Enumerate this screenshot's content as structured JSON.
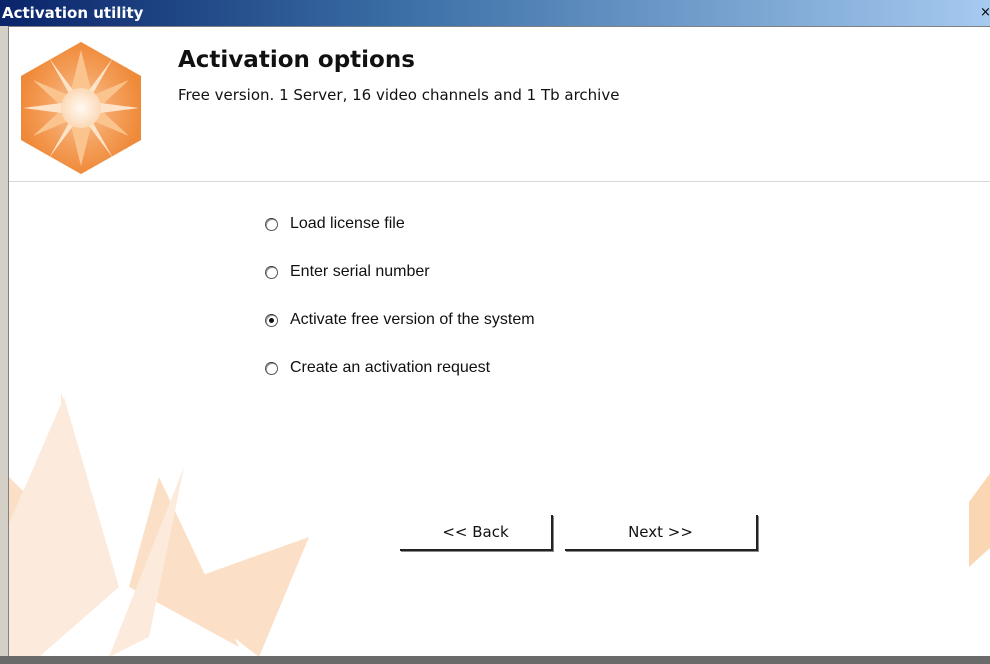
{
  "window": {
    "title": "Activation utility",
    "close_glyph": "×"
  },
  "header": {
    "heading": "Activation options",
    "subheading": "Free version. 1 Server, 16 video channels and 1 Tb archive"
  },
  "options": [
    {
      "label": "Load license file",
      "selected": false
    },
    {
      "label": "Enter serial number",
      "selected": false
    },
    {
      "label": "Activate free version of the system",
      "selected": true
    },
    {
      "label": "Create an activation request",
      "selected": false
    }
  ],
  "buttons": {
    "back_label": "<< Back",
    "next_label": "Next >>"
  },
  "colors": {
    "accent": "#f0903c",
    "titlebar_start": "#0a246a",
    "titlebar_end": "#a6caf0"
  },
  "icons": {
    "logo": "orange-hexagon-star-logo",
    "close": "close-icon"
  }
}
